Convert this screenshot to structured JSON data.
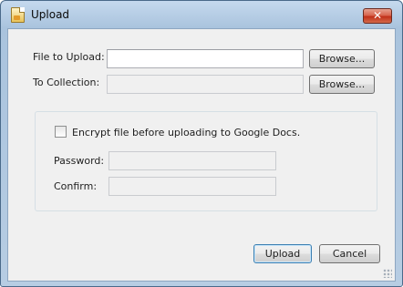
{
  "window": {
    "title": "Upload",
    "close_glyph": "✕"
  },
  "form": {
    "file_label": "File to Upload:",
    "file_value": "",
    "collection_label": "To Collection:",
    "collection_value": "",
    "browse_label_1": "Browse...",
    "browse_label_2": "Browse..."
  },
  "encryption": {
    "checkbox_label": "Encrypt file before uploading to Google Docs.",
    "checked": false,
    "password_label": "Password:",
    "confirm_label": "Confirm:"
  },
  "actions": {
    "upload_label": "Upload",
    "cancel_label": "Cancel"
  },
  "icons": {
    "app": "upload-app-icon",
    "close": "close-icon",
    "grip": "resize-grip-icon"
  },
  "colors": {
    "close_button": "#c2301a",
    "default_button_border": "#3c7fb1"
  }
}
